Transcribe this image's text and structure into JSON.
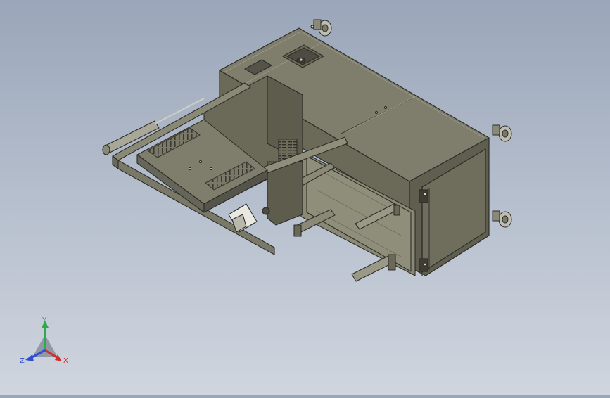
{
  "viewport": {
    "model": "machine-assembly",
    "colors": {
      "body_top": "#7f7e6c",
      "body_front": "#6b6a59",
      "body_side": "#5f5e4f",
      "edge": "#2d2d28",
      "accent_light": "#d9d8cc"
    }
  },
  "triad": {
    "x_label": "X",
    "y_label": "Y",
    "z_label": "Z",
    "colors": {
      "x": "#d22b2b",
      "y": "#2fa84f",
      "z": "#2f4fd0"
    }
  }
}
